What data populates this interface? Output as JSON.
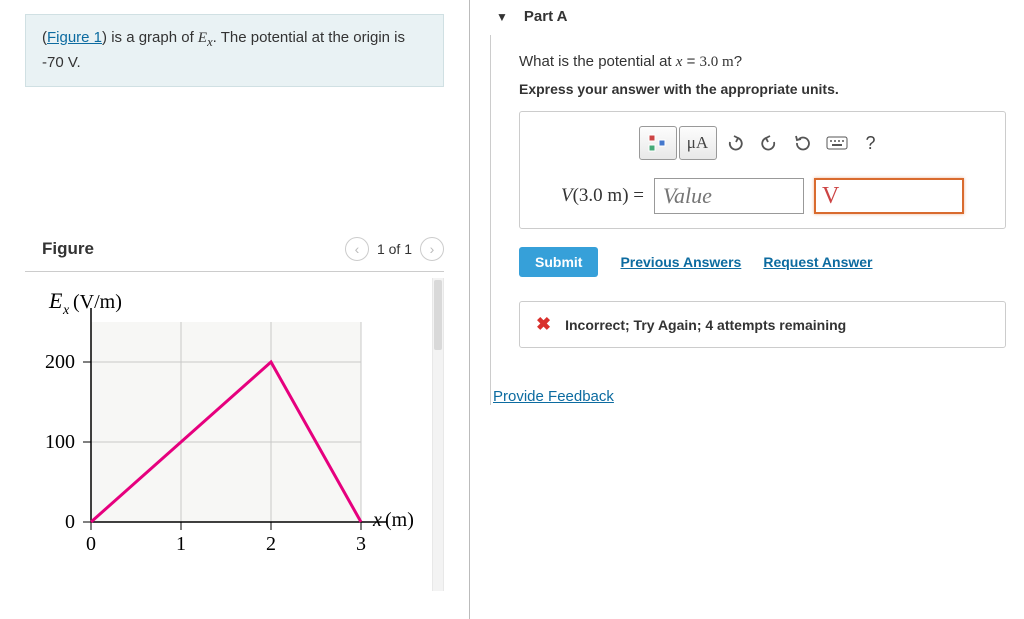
{
  "problem": {
    "figure_link_text": "Figure 1",
    "statement_before": "(",
    "statement_mid": ") is a graph of ",
    "ex_symbol": "E",
    "ex_sub": "x",
    "statement_after": ". The potential at the origin is ",
    "potential_value": "-70 V",
    "statement_end": "."
  },
  "figure": {
    "heading": "Figure",
    "nav_position": "1 of 1"
  },
  "chart_data": {
    "type": "line",
    "x": [
      0,
      2,
      3
    ],
    "y": [
      0,
      200,
      0
    ],
    "xlabel": "x (m)",
    "ylabel": "E_x (V/m)",
    "xlim": [
      0,
      3
    ],
    "ylim": [
      0,
      200
    ],
    "xticks": [
      0,
      1,
      2,
      3
    ],
    "yticks": [
      0,
      100,
      200
    ]
  },
  "part": {
    "label": "Part A",
    "question_pre": "What is the potential at ",
    "question_var": "x",
    "question_eq": " = ",
    "question_val": "3.0 m",
    "question_post": "?",
    "instruction": "Express your answer with the appropriate units."
  },
  "toolbar": {
    "mu_label": "μA"
  },
  "answer": {
    "label_V": "V",
    "label_open": "(",
    "label_arg": "3.0 m",
    "label_close": ")",
    "label_eq": " = ",
    "value_placeholder": "Value",
    "unit_value": "V"
  },
  "actions": {
    "submit": "Submit",
    "previous": "Previous Answers",
    "request": "Request Answer"
  },
  "feedback": {
    "message": "Incorrect; Try Again; 4 attempts remaining"
  },
  "links": {
    "provide_feedback": "Provide Feedback"
  }
}
